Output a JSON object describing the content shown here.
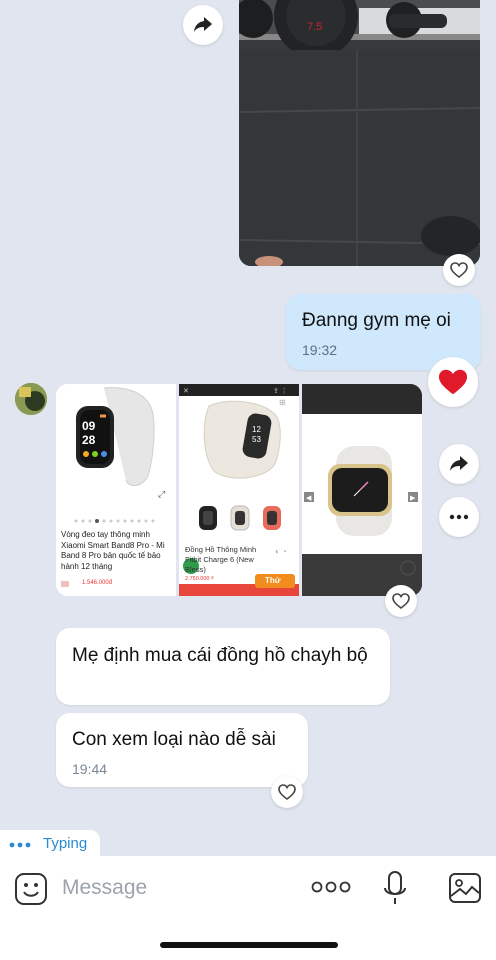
{
  "messages": {
    "sent_text": "Đanng gym mẹ oi",
    "sent_time": "19:32",
    "recv1_text": "Mẹ định mua cái đồng hồ chayh bộ",
    "recv2_text": "Con xem loại nào dễ sài",
    "recv2_time": "19:44"
  },
  "products": {
    "p1": {
      "time_digits": "09\n28",
      "title": "Vòng đeo tay thông minh Xiaomi Smart Band8 Pro - Mi Band 8 Pro bản quốc tế bảo hành 12 tháng",
      "price": "1.546.000đ"
    },
    "p2": {
      "site": "fptshop.com",
      "title": "Đồng Hồ Thông Minh Fitbit Charge 6 (New Bless)",
      "price": "2.750.000 ₫",
      "badge": "Thử"
    }
  },
  "status": {
    "typing": "Typing"
  },
  "composer": {
    "placeholder": "Message"
  },
  "colors": {
    "accent": "#2a8bd3",
    "sent_bubble": "#cfe8fb",
    "background": "#e1e5ef",
    "heart": "#e01a2b"
  },
  "icons": [
    "share-icon",
    "heart-icon",
    "more-icon",
    "sticker-icon",
    "mic-icon",
    "image-icon",
    "avatar"
  ]
}
